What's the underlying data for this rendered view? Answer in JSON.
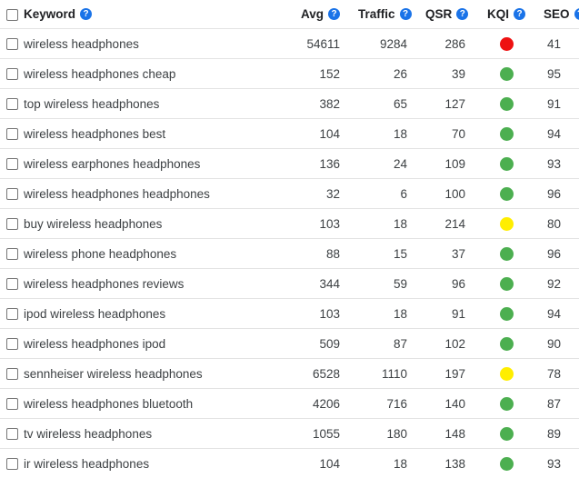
{
  "table": {
    "select_all_checkbox_checked": false,
    "columns": [
      {
        "key": "keyword",
        "label": "Keyword",
        "help_icon": "help-circle-icon",
        "align": "left"
      },
      {
        "key": "avg",
        "label": "Avg",
        "help_icon": "help-circle-icon",
        "align": "right"
      },
      {
        "key": "traffic",
        "label": "Traffic",
        "help_icon": "help-circle-icon",
        "align": "right"
      },
      {
        "key": "qsr",
        "label": "QSR",
        "help_icon": "help-circle-icon",
        "align": "right"
      },
      {
        "key": "kqi",
        "label": "KQI",
        "help_icon": "help-circle-icon",
        "align": "center"
      },
      {
        "key": "seo",
        "label": "SEO",
        "help_icon": "help-circle-icon",
        "align": "right"
      }
    ],
    "help_icon_glyph": "?",
    "kqi_colors": {
      "red": "#ee1111",
      "yellow": "#ffee00",
      "green": "#4caf50"
    },
    "rows": [
      {
        "checked": false,
        "keyword": "wireless headphones",
        "avg": "54611",
        "traffic": "9284",
        "qsr": "286",
        "kqi": "red",
        "seo": "41"
      },
      {
        "checked": false,
        "keyword": "wireless headphones cheap",
        "avg": "152",
        "traffic": "26",
        "qsr": "39",
        "kqi": "green",
        "seo": "95"
      },
      {
        "checked": false,
        "keyword": "top wireless headphones",
        "avg": "382",
        "traffic": "65",
        "qsr": "127",
        "kqi": "green",
        "seo": "91"
      },
      {
        "checked": false,
        "keyword": "wireless headphones best",
        "avg": "104",
        "traffic": "18",
        "qsr": "70",
        "kqi": "green",
        "seo": "94"
      },
      {
        "checked": false,
        "keyword": "wireless earphones headphones",
        "avg": "136",
        "traffic": "24",
        "qsr": "109",
        "kqi": "green",
        "seo": "93"
      },
      {
        "checked": false,
        "keyword": "wireless headphones headphones",
        "avg": "32",
        "traffic": "6",
        "qsr": "100",
        "kqi": "green",
        "seo": "96"
      },
      {
        "checked": false,
        "keyword": "buy wireless headphones",
        "avg": "103",
        "traffic": "18",
        "qsr": "214",
        "kqi": "yellow",
        "seo": "80"
      },
      {
        "checked": false,
        "keyword": "wireless phone headphones",
        "avg": "88",
        "traffic": "15",
        "qsr": "37",
        "kqi": "green",
        "seo": "96"
      },
      {
        "checked": false,
        "keyword": "wireless headphones reviews",
        "avg": "344",
        "traffic": "59",
        "qsr": "96",
        "kqi": "green",
        "seo": "92"
      },
      {
        "checked": false,
        "keyword": "ipod wireless headphones",
        "avg": "103",
        "traffic": "18",
        "qsr": "91",
        "kqi": "green",
        "seo": "94"
      },
      {
        "checked": false,
        "keyword": "wireless headphones ipod",
        "avg": "509",
        "traffic": "87",
        "qsr": "102",
        "kqi": "green",
        "seo": "90"
      },
      {
        "checked": false,
        "keyword": "sennheiser wireless headphones",
        "avg": "6528",
        "traffic": "1110",
        "qsr": "197",
        "kqi": "yellow",
        "seo": "78"
      },
      {
        "checked": false,
        "keyword": "wireless headphones bluetooth",
        "avg": "4206",
        "traffic": "716",
        "qsr": "140",
        "kqi": "green",
        "seo": "87"
      },
      {
        "checked": false,
        "keyword": "tv wireless headphones",
        "avg": "1055",
        "traffic": "180",
        "qsr": "148",
        "kqi": "green",
        "seo": "89"
      },
      {
        "checked": false,
        "keyword": "ir wireless headphones",
        "avg": "104",
        "traffic": "18",
        "qsr": "138",
        "kqi": "green",
        "seo": "93"
      }
    ]
  }
}
